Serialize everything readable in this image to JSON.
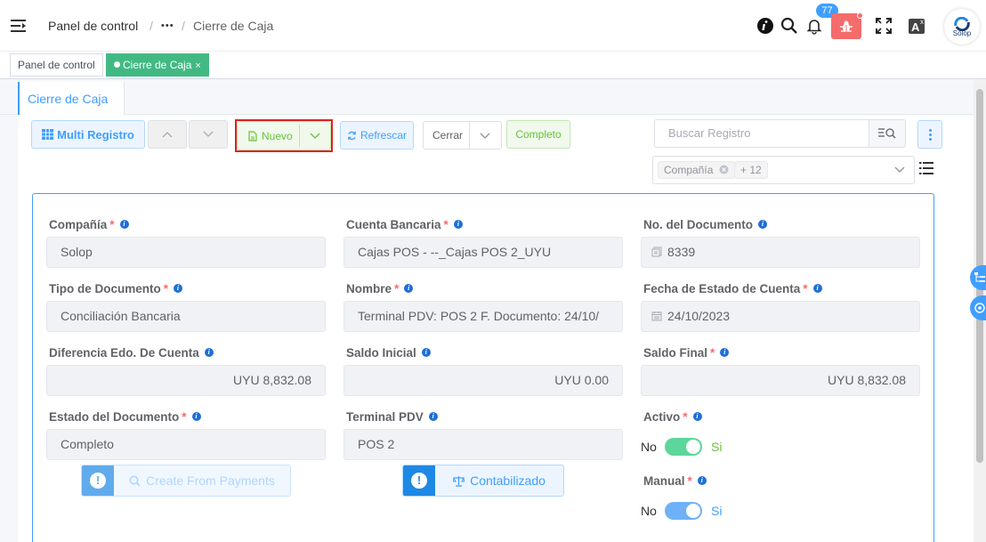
{
  "header": {
    "breadcrumb": [
      "Panel de control",
      "•••",
      "Cierre de Caja"
    ],
    "separator": "/",
    "notifications_count": "77",
    "avatar_label": "Solop"
  },
  "tags": [
    {
      "label": "Panel de control",
      "active": false
    },
    {
      "label": "Cierre de Caja",
      "active": true,
      "close": "×"
    }
  ],
  "tab": {
    "label": "Cierre de Caja"
  },
  "toolbar": {
    "multi_registro": "Multi Registro",
    "nuevo": "Nuevo",
    "refrescar": "Refrescar",
    "cerrar": "Cerrar",
    "completo": "Completo",
    "search_placeholder": "Buscar Registro",
    "filter_chip": "Compañía",
    "filter_more": "+ 12"
  },
  "form": {
    "required_mark": "*",
    "info_mark": "i",
    "compania": {
      "label": "Compañía",
      "value": "Solop"
    },
    "cuenta_bancaria": {
      "label": "Cuenta Bancaria",
      "value": "Cajas POS - --_Cajas POS 2_UYU"
    },
    "no_documento": {
      "label": "No. del Documento",
      "value": "8339"
    },
    "tipo_documento": {
      "label": "Tipo de Documento",
      "value": "Conciliación Bancaria"
    },
    "nombre": {
      "label": "Nombre",
      "value": "Terminal PDV: POS 2 F. Documento: 24/10/"
    },
    "fecha_estado": {
      "label": "Fecha de Estado de Cuenta",
      "value": "24/10/2023"
    },
    "diferencia": {
      "label": "Diferencia Edo. De Cuenta",
      "value": "UYU 8,832.08"
    },
    "saldo_inicial": {
      "label": "Saldo Inicial",
      "value": "UYU 0.00"
    },
    "saldo_final": {
      "label": "Saldo Final",
      "value": "UYU 8,832.08"
    },
    "estado_documento": {
      "label": "Estado del Documento",
      "value": "Completo"
    },
    "terminal_pdv": {
      "label": "Terminal PDV",
      "value": "POS 2"
    },
    "activo": {
      "label": "Activo",
      "off": "No",
      "on": "Si",
      "checked": true
    },
    "manual": {
      "label": "Manual",
      "off": "No",
      "on": "Si",
      "checked": true
    }
  },
  "actions": {
    "create_from_payments": "Create From Payments",
    "contabilizado": "Contabilizado"
  },
  "colors": {
    "primary": "#409eff",
    "success": "#67c23a",
    "danger": "#f56c6c",
    "active_tag": "#42b983"
  }
}
